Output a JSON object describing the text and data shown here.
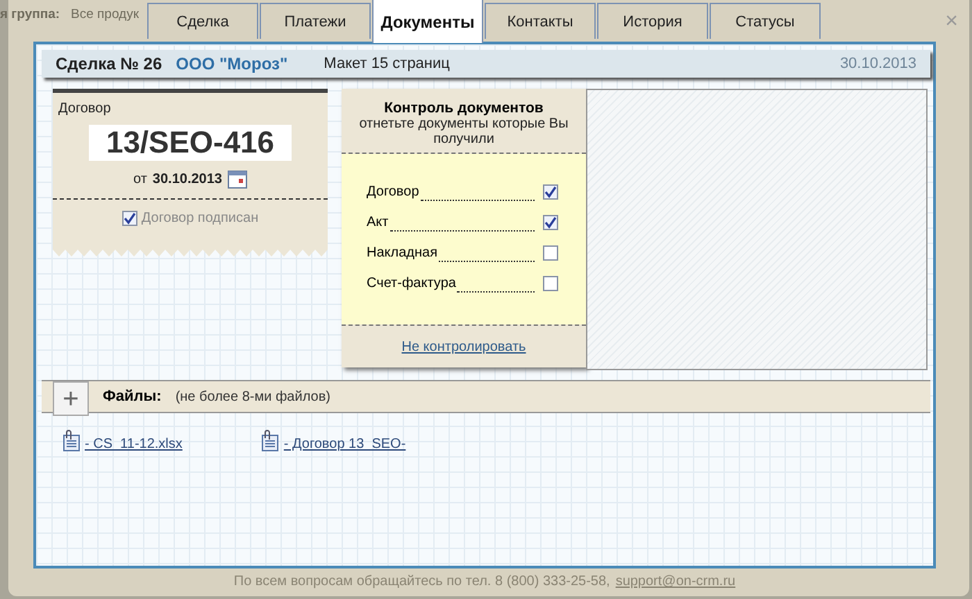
{
  "background": {
    "group_label": "я группа:",
    "group_value": "Все продук",
    "footer": "По всем вопросам обращайтесь по тел. 8 (800) 333-25-58,",
    "footer_link": "support@on-crm.ru"
  },
  "tabs": [
    {
      "label": "Сделка",
      "selected": false
    },
    {
      "label": "Платежи",
      "selected": false
    },
    {
      "label": "Документы",
      "selected": true
    },
    {
      "label": "Контакты",
      "selected": false
    },
    {
      "label": "История",
      "selected": false
    },
    {
      "label": "Статусы",
      "selected": false
    }
  ],
  "close": "×",
  "deal": {
    "title": "Сделка № 26",
    "company": "ООО \"Мороз\"",
    "note": "Макет 15 страниц",
    "date": "30.10.2013"
  },
  "contract": {
    "label": "Договор",
    "number": "13/SEO-416",
    "date_prefix": "от",
    "date": "30.10.2013",
    "signed_label": "Договор подписан",
    "signed": true
  },
  "control": {
    "title": "Контроль документов",
    "subtitle": "отнетьте документы которые Вы получили",
    "items": [
      {
        "label": "Договор",
        "checked": true
      },
      {
        "label": "Акт",
        "checked": true
      },
      {
        "label": "Накладная",
        "checked": false
      },
      {
        "label": "Счет-фактура",
        "checked": false
      }
    ],
    "link": "Не контролировать"
  },
  "files": {
    "add": "+",
    "title": "Файлы:",
    "hint": "(не более 8-ми файлов)",
    "items": [
      "- CS  11-12.xlsx",
      "- Договор 13  SEO-"
    ]
  }
}
